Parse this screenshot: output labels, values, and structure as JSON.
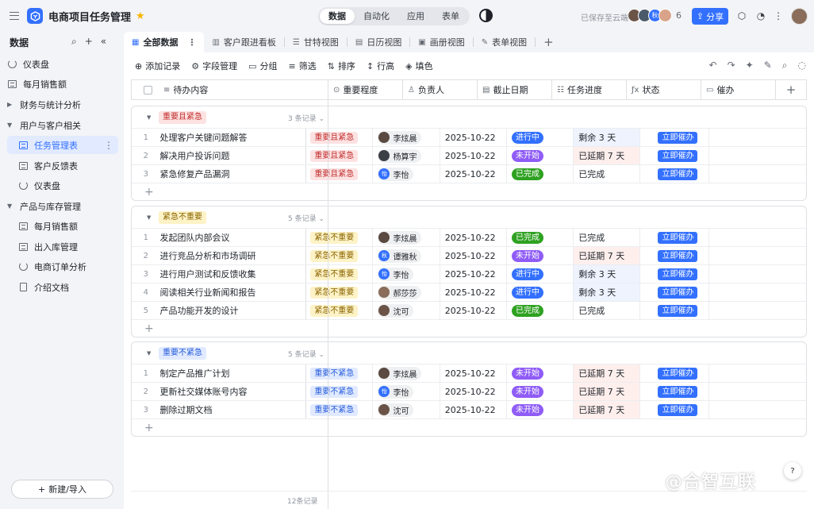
{
  "app": {
    "title": "电商项目任务管理",
    "mode_tabs": [
      "数据",
      "自动化",
      "应用",
      "表单"
    ],
    "saved_status": "已保存至云端",
    "collaborator_count": "6",
    "collaborator_initial": "秋",
    "share_label": "分享"
  },
  "sidebar": {
    "heading": "数据",
    "items": [
      {
        "label": "仪表盘",
        "icon": "dashboard-icon"
      },
      {
        "label": "每月销售额",
        "icon": "grid-table-icon"
      },
      {
        "label": "财务与统计分析",
        "icon": "caret-right-icon"
      },
      {
        "label": "用户与客户相关",
        "icon": "caret-down-icon"
      },
      {
        "label": "任务管理表",
        "icon": "grid-table-icon"
      },
      {
        "label": "客户反馈表",
        "icon": "grid-table-icon"
      },
      {
        "label": "仪表盘",
        "icon": "dashboard-icon"
      },
      {
        "label": "产品与库存管理",
        "icon": "caret-down-icon"
      },
      {
        "label": "每月销售额",
        "icon": "grid-table-icon"
      },
      {
        "label": "出入库管理",
        "icon": "grid-table-icon"
      },
      {
        "label": "电商订单分析",
        "icon": "dashboard-icon"
      },
      {
        "label": "介绍文档",
        "icon": "document-icon"
      }
    ],
    "new_button": "新建/导入"
  },
  "view_tabs": [
    "全部数据",
    "客户跟进看板",
    "甘特视图",
    "日历视图",
    "画册视图",
    "表单视图"
  ],
  "toolbar": [
    "添加记录",
    "字段管理",
    "分组",
    "筛选",
    "排序",
    "行高",
    "填色"
  ],
  "columns": [
    "待办内容",
    "重要程度",
    "负责人",
    "截止日期",
    "任务进度",
    "状态",
    "催办"
  ],
  "groups": [
    {
      "label": "重要且紧急",
      "count": "3 条记录",
      "rows": [
        {
          "num": "1",
          "title": "处理客户关键问题解答",
          "priority": "重要且紧急",
          "owner": "李炫晨",
          "date": "2025-10-22",
          "progress": "进行中",
          "status": "剩余 3 天",
          "urge": "立即催办"
        },
        {
          "num": "2",
          "title": "解决用户投诉问题",
          "priority": "重要且紧急",
          "owner": "杨算宇",
          "date": "2025-10-22",
          "progress": "未开始",
          "status": "已延期 7 天",
          "urge": "立即催办"
        },
        {
          "num": "3",
          "title": "紧急修复产品漏洞",
          "priority": "重要且紧急",
          "owner": "李怡",
          "date": "2025-10-22",
          "progress": "已完成",
          "status": "已完成",
          "urge": "立即催办"
        }
      ]
    },
    {
      "label": "紧急不重要",
      "count": "5 条记录",
      "rows": [
        {
          "num": "1",
          "title": "发起团队内部会议",
          "priority": "紧急不重要",
          "owner": "李炫晨",
          "date": "2025-10-22",
          "progress": "已完成",
          "status": "已完成",
          "urge": "立即催办"
        },
        {
          "num": "2",
          "title": "进行竞品分析和市场调研",
          "priority": "紧急不重要",
          "owner": "谭雅秋",
          "date": "2025-10-22",
          "progress": "未开始",
          "status": "已延期 7 天",
          "urge": "立即催办"
        },
        {
          "num": "3",
          "title": "进行用户测试和反馈收集",
          "priority": "紧急不重要",
          "owner": "李怡",
          "date": "2025-10-22",
          "progress": "进行中",
          "status": "剩余 3 天",
          "urge": "立即催办"
        },
        {
          "num": "4",
          "title": "阅读相关行业新闻和报告",
          "priority": "紧急不重要",
          "owner": "郝莎莎",
          "date": "2025-10-22",
          "progress": "进行中",
          "status": "剩余 3 天",
          "urge": "立即催办"
        },
        {
          "num": "5",
          "title": "产品功能开发的设计",
          "priority": "紧急不重要",
          "owner": "沈可",
          "date": "2025-10-22",
          "progress": "已完成",
          "status": "已完成",
          "urge": "立即催办"
        }
      ]
    },
    {
      "label": "重要不紧急",
      "count": "5 条记录",
      "rows": [
        {
          "num": "1",
          "title": "制定产品推广计划",
          "priority": "重要不紧急",
          "owner": "李炫晨",
          "date": "2025-10-22",
          "progress": "未开始",
          "status": "已延期 7 天",
          "urge": "立即催办"
        },
        {
          "num": "2",
          "title": "更新社交媒体账号内容",
          "priority": "重要不紧急",
          "owner": "李怡",
          "date": "2025-10-22",
          "progress": "未开始",
          "status": "已延期 7 天",
          "urge": "立即催办"
        },
        {
          "num": "3",
          "title": "删除过期文档",
          "priority": "重要不紧急",
          "owner": "沈可",
          "date": "2025-10-22",
          "progress": "未开始",
          "status": "已延期 7 天",
          "urge": "立即催办"
        }
      ]
    }
  ],
  "footer_count": "12条记录",
  "watermark": "@合智互联",
  "help_badge": "?",
  "colors": {
    "accent": "#3370ff",
    "priority_urgent_important": "#fde2e2",
    "priority_urgent_only": "#fdf3c7",
    "priority_important_only": "#e1eaff",
    "progress_in_progress": "#3370ff",
    "progress_not_started": "#8f5cf6",
    "progress_done": "#2ea121"
  }
}
